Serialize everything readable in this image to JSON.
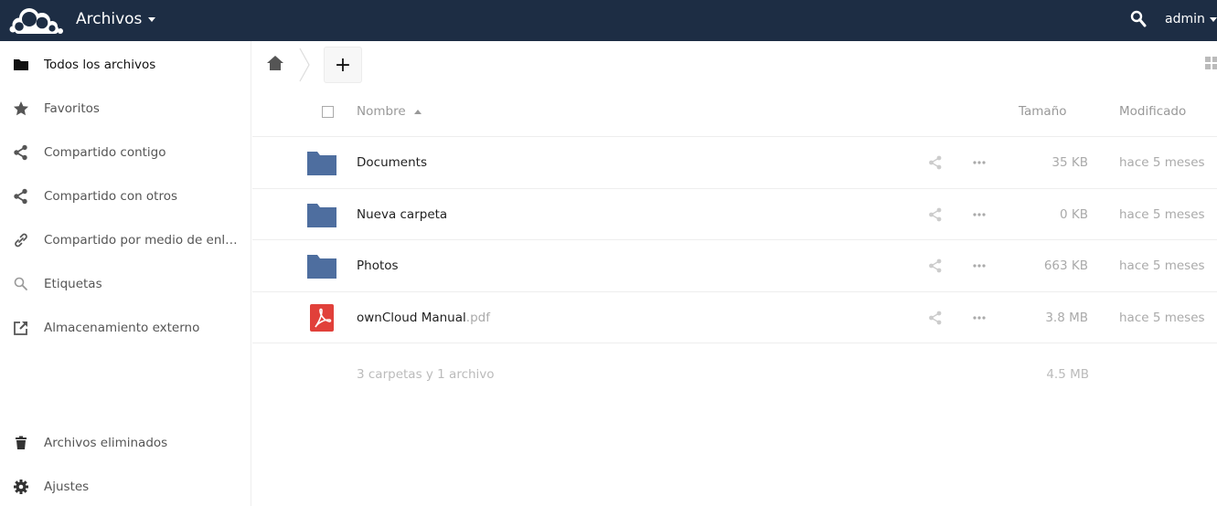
{
  "header": {
    "app_title": "Archivos",
    "user": "admin",
    "bg_color": "#1d2d44"
  },
  "sidebar": {
    "items": [
      {
        "label": "Todos los archivos",
        "icon": "folder-icon",
        "active": true
      },
      {
        "label": "Favoritos",
        "icon": "star-icon"
      },
      {
        "label": "Compartido contigo",
        "icon": "share-icon"
      },
      {
        "label": "Compartido con otros",
        "icon": "share-icon"
      },
      {
        "label": "Compartido por medio de enla...",
        "icon": "link-icon"
      },
      {
        "label": "Etiquetas",
        "icon": "search-icon"
      },
      {
        "label": "Almacenamiento externo",
        "icon": "external-icon"
      }
    ],
    "bottom_items": [
      {
        "label": "Archivos eliminados",
        "icon": "trash-icon"
      },
      {
        "label": "Ajustes",
        "icon": "gear-icon"
      }
    ]
  },
  "controls": {
    "add_label": "+"
  },
  "table": {
    "headers": {
      "name": "Nombre",
      "size": "Tamaño",
      "modified": "Modificado"
    },
    "rows": [
      {
        "name": "Documents",
        "ext": "",
        "type": "folder",
        "size": "35 KB",
        "modified": "hace 5 meses"
      },
      {
        "name": "Nueva carpeta",
        "ext": "",
        "type": "folder",
        "size": "0 KB",
        "modified": "hace 5 meses"
      },
      {
        "name": "Photos",
        "ext": "",
        "type": "folder",
        "size": "663 KB",
        "modified": "hace 5 meses"
      },
      {
        "name": "ownCloud Manual",
        "ext": ".pdf",
        "type": "pdf",
        "size": "3.8 MB",
        "modified": "hace 5 meses"
      }
    ],
    "summary": "3 carpetas y 1 archivo",
    "summary_size": "4.5 MB"
  },
  "colors": {
    "folder": "#4e6e9f",
    "pdf": "#e1403a"
  }
}
